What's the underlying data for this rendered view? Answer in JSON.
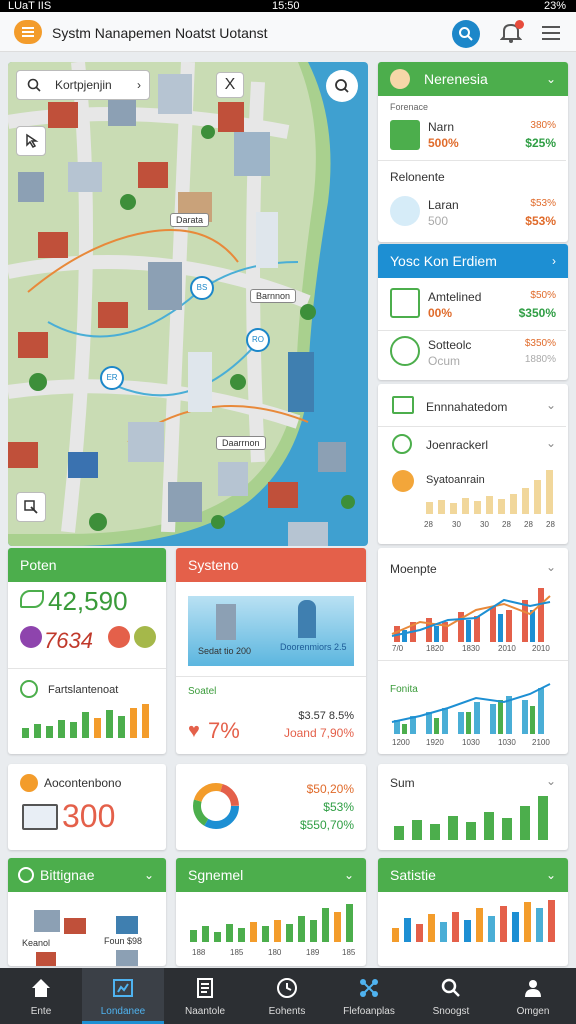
{
  "status": {
    "left": "LUaT IIS",
    "time": "15:50",
    "battery": "23%"
  },
  "app": {
    "title": "Systm Nanapemen Noatst Uotanst"
  },
  "map": {
    "search_text": "Kortpjenjin",
    "close_glyph": "X",
    "labels": [
      "Darata",
      "Barnnon",
      "Daarrnon"
    ],
    "pins": [
      "BS",
      "ER",
      "RO"
    ]
  },
  "right_panel": {
    "header": "Nerenesia",
    "section1_label": "Forenace",
    "item1": {
      "name": "Narn",
      "value": "500%",
      "p1": "380%",
      "p2": "$25%"
    },
    "section2_label": "Relonente",
    "item2": {
      "name": "Laran",
      "value": "500",
      "p1": "$53%",
      "p2": "$53%"
    },
    "blue_header": "Yosc Kon Erdiem",
    "item3": {
      "name": "Amtelined",
      "value": "00%",
      "p1": "$50%",
      "p2": "$350%"
    },
    "item4": {
      "name": "Sotteolc",
      "value": "Ocum",
      "p1": "$350%",
      "p2": "1880%"
    },
    "row5_label": "Ennnahatedom",
    "row6_label": "Joenrackerl",
    "row7_label": "Syatoanrain",
    "chart_ticks": [
      "28",
      "30",
      "30",
      "28",
      "28",
      "28"
    ]
  },
  "cards": {
    "poten": {
      "header": "Poten",
      "big": "42,590",
      "sub": "7634",
      "sub_label": "Fartslantenoat"
    },
    "system": {
      "header": "Systeno",
      "img_label1": "Sedat tio 200",
      "img_label2": "Doorenmiors 2.5",
      "small_label": "Soatel",
      "percent": "7%",
      "stat1": "$3.57 8.5%",
      "stat2": "Joand 7,90%"
    },
    "moenpta": {
      "title": "Moenpte",
      "ticks1": [
        "7/0",
        "1820",
        "1830",
        "2010",
        "2010"
      ],
      "label2": "Fonita",
      "ticks2": [
        "1200",
        "1920",
        "1030",
        "1030",
        "2100"
      ]
    },
    "account": {
      "title": "Aocontenbono",
      "value": "300"
    },
    "donut": {
      "v1": "$50,20%",
      "v2": "$53%",
      "v3": "$550,70%"
    },
    "sum": {
      "title": "Sum"
    },
    "bottom1": {
      "header": "Bittignae",
      "label1": "Keanol",
      "label2": "Foun $98"
    },
    "bottom2": {
      "header": "Sgnemel",
      "ticks": [
        "188",
        "185",
        "180",
        "189",
        "185"
      ]
    },
    "bottom3": {
      "header": "Satistie"
    }
  },
  "nav": [
    {
      "label": "Ente"
    },
    {
      "label": "Londanee"
    },
    {
      "label": "Naantole"
    },
    {
      "label": "Eohents"
    },
    {
      "label": "Flefoanplas"
    },
    {
      "label": "Snoogst"
    },
    {
      "label": "Omgen"
    }
  ],
  "colors": {
    "green": "#4cae4c",
    "red": "#e4604a",
    "blue": "#1d8fd3",
    "orange": "#f39c2b"
  }
}
